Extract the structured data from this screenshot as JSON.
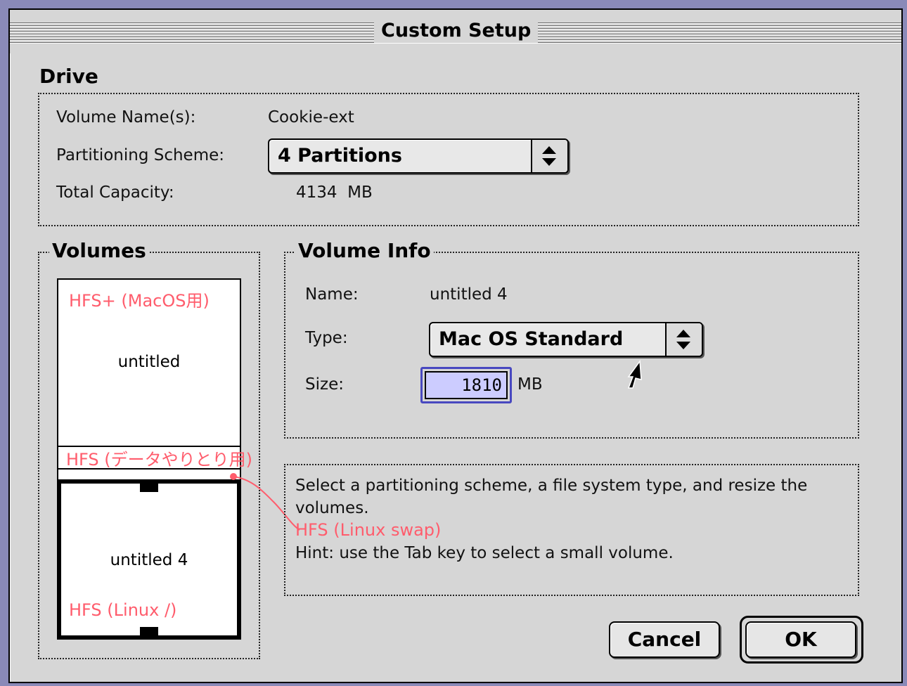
{
  "window": {
    "title": "Custom Setup"
  },
  "drive": {
    "heading": "Drive",
    "volume_names_label": "Volume Name(s):",
    "volume_names_value": "Cookie-ext",
    "partitioning_label": "Partitioning Scheme:",
    "partitioning_value": "4 Partitions",
    "capacity_label": "Total Capacity:",
    "capacity_value": "4134  MB"
  },
  "volumes": {
    "heading": "Volumes",
    "items": [
      {
        "name": "untitled",
        "annotation": "HFS+ (MacOS用)"
      },
      {
        "name": "",
        "annotation": "HFS (データやりとり用)"
      },
      {
        "name": "",
        "annotation": "HFS (Linux swap)"
      },
      {
        "name": "untitled 4",
        "annotation": "HFS (Linux /)"
      }
    ]
  },
  "volume_info": {
    "heading": "Volume Info",
    "name_label": "Name:",
    "name_value": "untitled 4",
    "type_label": "Type:",
    "type_value": "Mac OS Standard",
    "size_label": "Size:",
    "size_value": "1810",
    "size_unit": "MB"
  },
  "help": {
    "text_line1": "Select a partitioning scheme, a file system type, and resize the",
    "text_line2": "volumes.",
    "hint": "Hint: use the Tab key to select a small volume."
  },
  "buttons": {
    "cancel": "Cancel",
    "ok": "OK"
  },
  "colors": {
    "annotation": "#ff5c6c",
    "selection": "#ccccff",
    "focus": "#4848c0"
  }
}
